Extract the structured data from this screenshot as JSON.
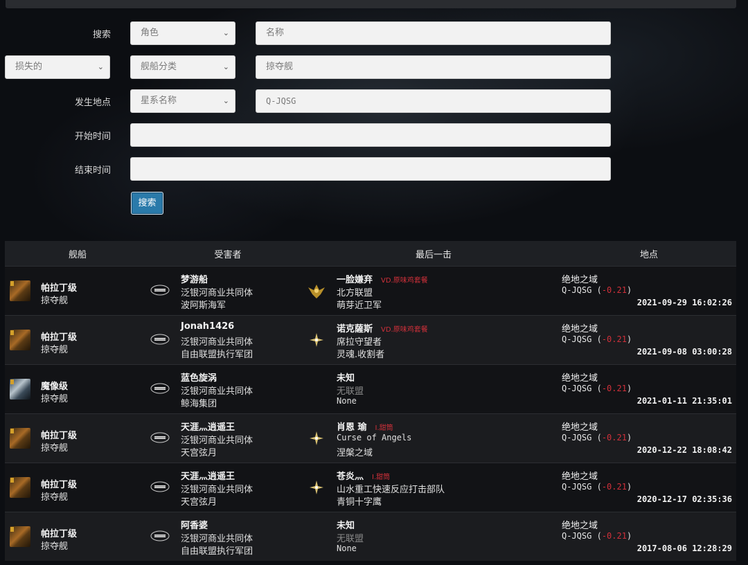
{
  "form": {
    "search_label": "搜索",
    "role_select": "角色",
    "name_placeholder": "名称",
    "loss_select": "损失的",
    "ship_category_select": "舰船分类",
    "ship_value": "掠夺舰",
    "location_label": "发生地点",
    "system_select": "星系名称",
    "system_value": "Q-JQSG",
    "start_label": "开始时间",
    "end_label": "结束时间",
    "submit_label": "搜索"
  },
  "table": {
    "headers": [
      "舰船",
      "受害者",
      "最后一击",
      "地点"
    ],
    "rows": [
      {
        "ship_name": "帕拉丁级",
        "ship_class": "掠夺舰",
        "ship_icon": "gold",
        "victim": {
          "pilot": "梦游船",
          "corp": "泛银河商业共同体",
          "alliance": "波阿斯海军"
        },
        "killer": {
          "pilot": "一脸嫌弃",
          "tag": "VD.原味鸡套餐",
          "corp": "北方联盟",
          "alliance": "萌芽近卫军",
          "logo": "wings-emblem-icon"
        },
        "region": "绝地之域",
        "system": "Q-JQSG",
        "security": "-0.21",
        "time": "2021-09-29 16:02:26"
      },
      {
        "ship_name": "帕拉丁级",
        "ship_class": "掠夺舰",
        "ship_icon": "gold",
        "victim": {
          "pilot": "Jonah1426",
          "corp": "泛银河商业共同体",
          "alliance": "自由联盟执行军团"
        },
        "killer": {
          "pilot": "诺克薩斯",
          "tag": "VD.原味鸡套餐",
          "corp": "席拉守望者",
          "alliance": "灵魂.收割者",
          "logo": "star-emblem-icon"
        },
        "region": "绝地之域",
        "system": "Q-JQSG",
        "security": "-0.21",
        "time": "2021-09-08 03:00:28"
      },
      {
        "ship_name": "魔像级",
        "ship_class": "掠夺舰",
        "ship_icon": "blue",
        "victim": {
          "pilot": "蓝色旋涡",
          "corp": "泛银河商业共同体",
          "alliance": "鲸海集团"
        },
        "killer": {
          "pilot": "未知",
          "tag": "",
          "corp": "无联盟",
          "alliance": "None",
          "logo": ""
        },
        "region": "绝地之域",
        "system": "Q-JQSG",
        "security": "-0.21",
        "time": "2021-01-11 21:35:01"
      },
      {
        "ship_name": "帕拉丁级",
        "ship_class": "掠夺舰",
        "ship_icon": "gold",
        "victim": {
          "pilot": "天涯灬逍遥王",
          "corp": "泛银河商业共同体",
          "alliance": "天宫弦月"
        },
        "killer": {
          "pilot": "肖恩 瑜",
          "tag": "I.甜筒",
          "corp": "Curse of Angels",
          "alliance": "涅槃之域",
          "logo": "star-emblem-icon"
        },
        "region": "绝地之域",
        "system": "Q-JQSG",
        "security": "-0.21",
        "time": "2020-12-22 18:08:42"
      },
      {
        "ship_name": "帕拉丁级",
        "ship_class": "掠夺舰",
        "ship_icon": "gold",
        "victim": {
          "pilot": "天涯灬逍遥王",
          "corp": "泛银河商业共同体",
          "alliance": "天宫弦月"
        },
        "killer": {
          "pilot": "苍炎灬",
          "tag": "I.甜筒",
          "corp": "山水重工快速反应打击部队",
          "alliance": "青铜十字鹰",
          "logo": "star-emblem-icon"
        },
        "region": "绝地之域",
        "system": "Q-JQSG",
        "security": "-0.21",
        "time": "2020-12-17 02:35:36"
      },
      {
        "ship_name": "帕拉丁级",
        "ship_class": "掠夺舰",
        "ship_icon": "gold",
        "victim": {
          "pilot": "阿香婆",
          "corp": "泛银河商业共同体",
          "alliance": "自由联盟执行军团"
        },
        "killer": {
          "pilot": "未知",
          "tag": "",
          "corp": "无联盟",
          "alliance": "None",
          "logo": ""
        },
        "region": "绝地之域",
        "system": "Q-JQSG",
        "security": "-0.21",
        "time": "2017-08-06 12:28:29"
      }
    ]
  }
}
